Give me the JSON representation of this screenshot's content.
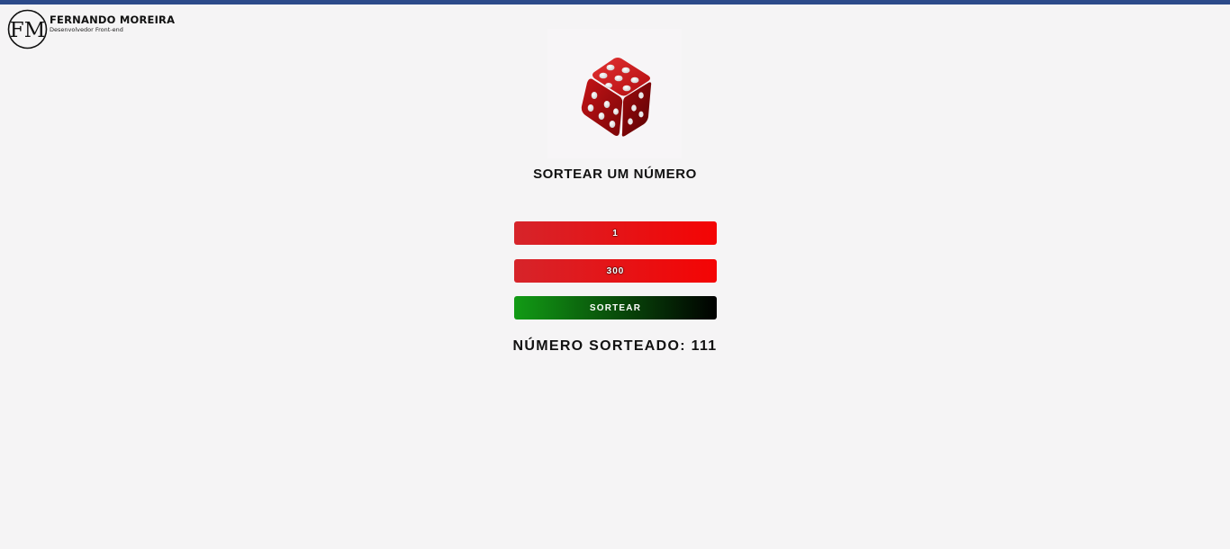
{
  "theme": {
    "accent": "#2c4a8a",
    "field_gradient": [
      "#d6242a",
      "#f40404"
    ],
    "button_gradient": [
      "#129b15",
      "#000000"
    ]
  },
  "brand": {
    "logo_letters": "FM",
    "name": "FERNANDO MOREIRA",
    "role": "Desenvolvedor Front-end",
    "logo_icon": "fm-monogram-logo"
  },
  "hero": {
    "icon": "red-dice-icon"
  },
  "main": {
    "title": "SORTEAR UM NÚMERO",
    "min_value": "1",
    "max_value": "300",
    "draw_button_label": "SORTEAR",
    "result_label": "NÚMERO SORTEADO:",
    "result_value": "111"
  }
}
